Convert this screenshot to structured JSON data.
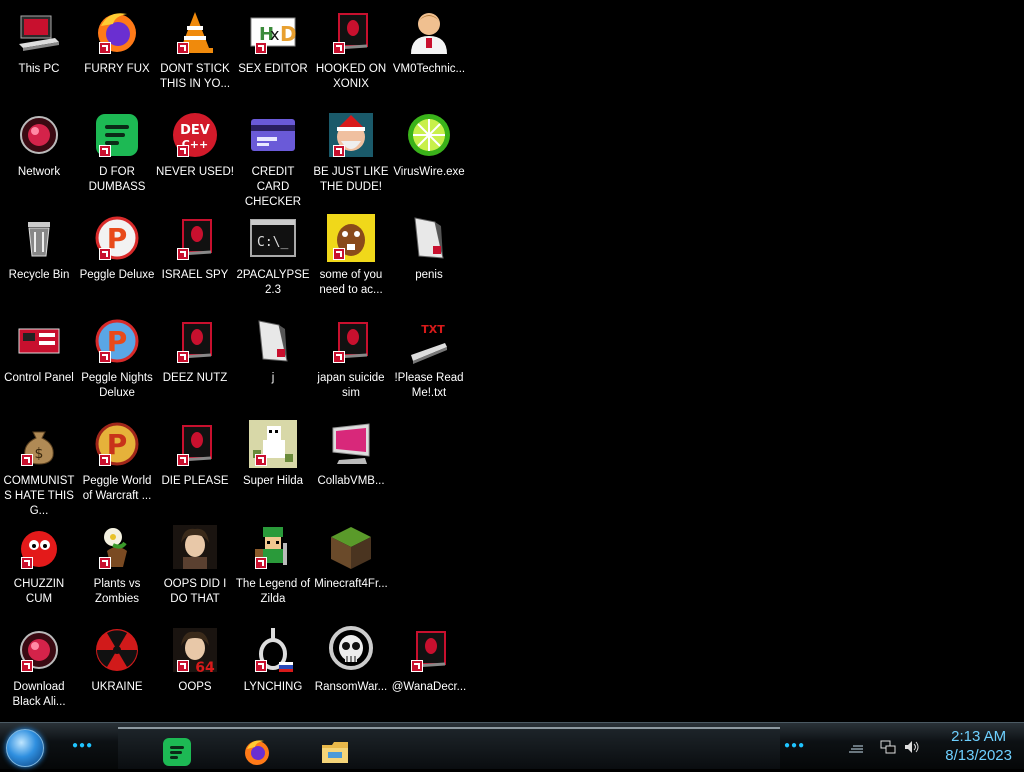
{
  "desktop": {
    "icons": [
      {
        "label": "This PC",
        "icon": "computer-icon"
      },
      {
        "label": "FURRY FUX",
        "icon": "firefox-icon"
      },
      {
        "label": "DONT STICK THIS IN YO...",
        "icon": "vlc-icon"
      },
      {
        "label": "SEX EDITOR",
        "icon": "hxd-icon"
      },
      {
        "label": "HOOKED ON XONIX",
        "icon": "alien-app-icon"
      },
      {
        "label": "VM0Technic...",
        "icon": "doctor-icon"
      },
      {
        "label": "Network",
        "icon": "network-icon"
      },
      {
        "label": "D FOR DUMBASS",
        "icon": "spotify-icon"
      },
      {
        "label": "NEVER USED!",
        "icon": "devcpp-icon"
      },
      {
        "label": "CREDIT CARD CHECKER",
        "icon": "credit-card-icon"
      },
      {
        "label": "BE JUST LIKE THE DUDE!",
        "icon": "dude-icon"
      },
      {
        "label": "VirusWire.exe",
        "icon": "limewire-icon"
      },
      {
        "label": "Recycle Bin",
        "icon": "recycle-bin-icon"
      },
      {
        "label": "Peggle Deluxe",
        "icon": "peggle-icon"
      },
      {
        "label": "ISRAEL SPY",
        "icon": "alien-app-icon"
      },
      {
        "label": "2PACALYPSE 2.3",
        "icon": "terminal-icon"
      },
      {
        "label": "some of you need to ac...",
        "icon": "beaver-icon"
      },
      {
        "label": "penis",
        "icon": "file-icon"
      },
      {
        "label": "Control Panel",
        "icon": "control-panel-icon"
      },
      {
        "label": "Peggle Nights Deluxe",
        "icon": "peggle-icon"
      },
      {
        "label": "DEEZ NUTZ",
        "icon": "alien-app-icon"
      },
      {
        "label": "j",
        "icon": "file-icon"
      },
      {
        "label": "japan suicide sim",
        "icon": "alien-app-icon"
      },
      {
        "label": "!Please Read Me!.txt",
        "icon": "txt-file-icon"
      },
      {
        "label": "COMMUNISTS HATE THIS G...",
        "icon": "money-bag-icon"
      },
      {
        "label": "Peggle World of Warcraft ...",
        "icon": "peggle-icon"
      },
      {
        "label": "DIE PLEASE",
        "icon": "alien-app-icon"
      },
      {
        "label": "Super Hilda",
        "icon": "pixel-game-icon"
      },
      {
        "label": "CollabVMB...",
        "icon": "monitor-icon"
      },
      {
        "label": "CHUZZIN CUM",
        "icon": "chuzzle-icon"
      },
      {
        "label": "Plants vs Zombies",
        "icon": "plant-icon"
      },
      {
        "label": "OOPS DID I DO THAT",
        "icon": "portrait-icon"
      },
      {
        "label": "The Legend of Zilda",
        "icon": "zilda-icon"
      },
      {
        "label": "Minecraft4Fr...",
        "icon": "minecraft-icon"
      },
      {
        "label": "Download Black Ali...",
        "icon": "network-icon"
      },
      {
        "label": "UKRAINE",
        "icon": "radiation-icon"
      },
      {
        "label": "OOPS",
        "icon": "portrait-64-icon"
      },
      {
        "label": "LYNCHING",
        "icon": "noose-icon"
      },
      {
        "label": "RansomWar...",
        "icon": "skull-icon"
      },
      {
        "label": "@WanaDecr...",
        "icon": "alien-app-icon"
      }
    ],
    "overlay_text": {
      "portrait_64": "64",
      "txt_badge": "TXT",
      "dev_badge": "DEV"
    }
  },
  "taskbar": {
    "pinned": [
      {
        "name": "spotify",
        "icon": "spotify-icon"
      },
      {
        "name": "firefox",
        "icon": "firefox-icon"
      },
      {
        "name": "file-explorer",
        "icon": "folder-icon"
      }
    ],
    "clock": {
      "time": "2:13 AM",
      "date": "8/13/2023"
    },
    "dots": "●●●"
  },
  "colors": {
    "accent": "#1fc4ff",
    "clock": "#6ed0ff",
    "shortcut": "#c8102e"
  }
}
